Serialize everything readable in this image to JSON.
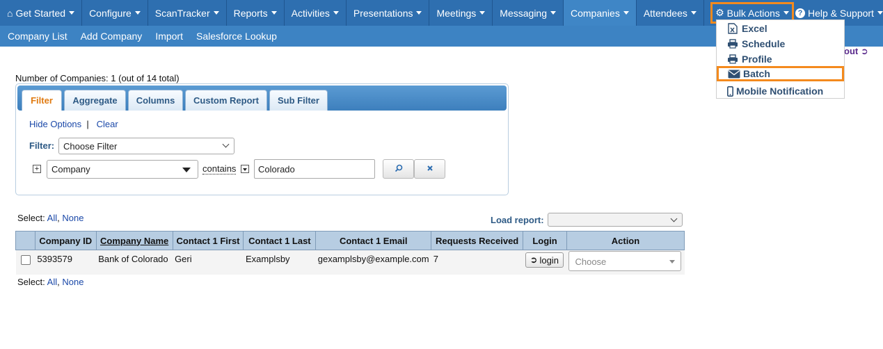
{
  "topnav": {
    "items": [
      {
        "label": "Get Started"
      },
      {
        "label": "Configure"
      },
      {
        "label": "ScanTracker"
      },
      {
        "label": "Reports"
      },
      {
        "label": "Activities"
      },
      {
        "label": "Presentations"
      },
      {
        "label": "Meetings"
      },
      {
        "label": "Messaging"
      },
      {
        "label": "Companies"
      },
      {
        "label": "Attendees"
      }
    ],
    "bulk_actions": "Bulk Actions",
    "help": "Help & Support"
  },
  "subnav": {
    "items": [
      "Company List",
      "Add Company",
      "Import",
      "Salesforce Lookup"
    ]
  },
  "bulk_menu": {
    "items": [
      "Excel",
      "Schedule",
      "Profile",
      "Batch",
      "Mobile Notification"
    ]
  },
  "logout": "out",
  "count_text": "Number of Companies: 1 (out of 14 total)",
  "filter_panel": {
    "tabs": [
      "Filter",
      "Aggregate",
      "Columns",
      "Custom Report",
      "Sub Filter"
    ],
    "hide_options": "Hide Options",
    "separator": "|",
    "clear": "Clear",
    "filter_label": "Filter:",
    "filter_select": "Choose Filter",
    "field_select": "Company",
    "operator": "contains",
    "value": "Colorado"
  },
  "select_controls": {
    "prefix": "Select:",
    "all": "All",
    "comma": ",",
    "none": "None"
  },
  "load_report_label": "Load report:",
  "table": {
    "headers": [
      "Company ID",
      "Company Name",
      "Contact 1 First",
      "Contact 1 Last",
      "Contact 1 Email",
      "Requests Received",
      "Login",
      "Action"
    ],
    "rows": [
      {
        "company_id": "5393579",
        "company_name": "Bank of Colorado",
        "first": "Geri",
        "last": "Examplsby",
        "email": "gexamplsby@example.com",
        "requests": "7",
        "login": "login",
        "action": "Choose"
      }
    ]
  },
  "colors": {
    "nav": "#2e6fb0",
    "subnav": "#3d83c3",
    "highlight": "#f48a1d",
    "header_row": "#b7cde2"
  }
}
